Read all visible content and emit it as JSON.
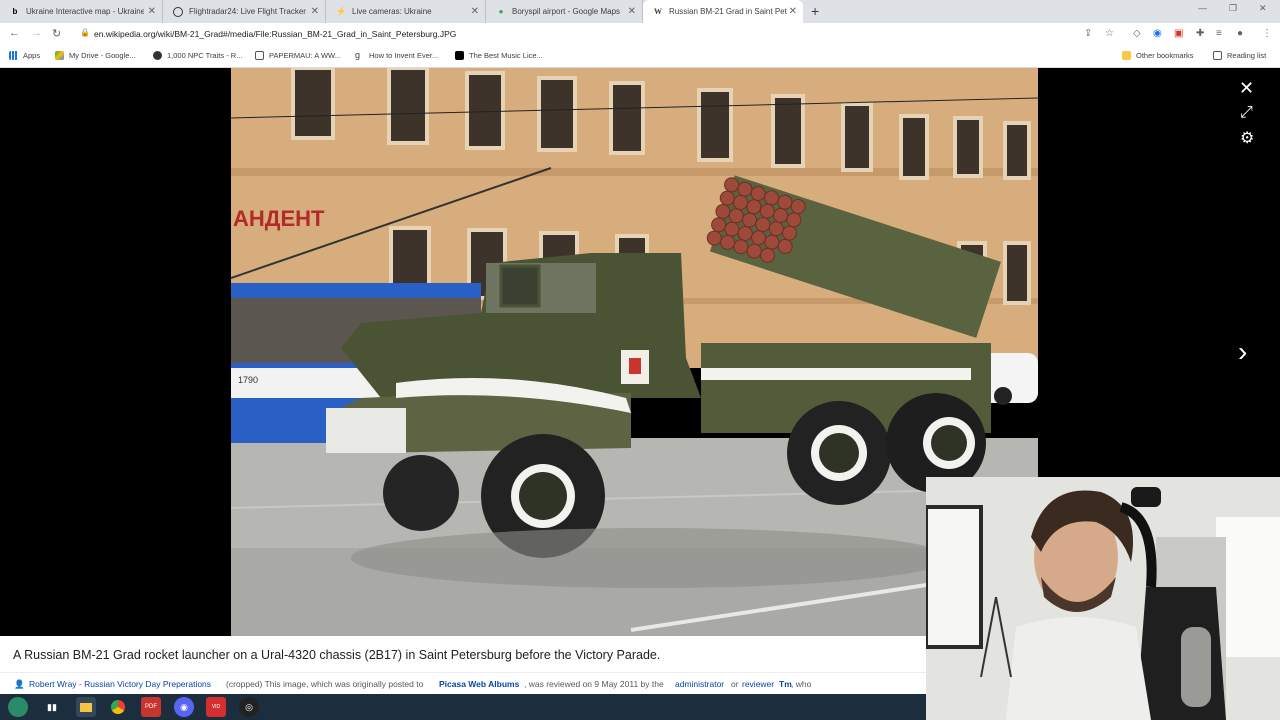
{
  "browser": {
    "tabs": [
      {
        "label": "Ukraine Interactive map - Ukraine",
        "icon": "liveuamap-icon",
        "active": false
      },
      {
        "label": "Flightradar24: Live Flight Tracker",
        "icon": "flightradar-icon",
        "active": false
      },
      {
        "label": "Live cameras: Ukraine",
        "icon": "camera-icon",
        "active": false
      },
      {
        "label": "Boryspil airport - Google Maps",
        "icon": "maps-pin-icon",
        "active": false
      },
      {
        "label": "Russian BM-21 Grad in Saint Peters",
        "icon": "wikipedia-icon",
        "active": true
      }
    ],
    "new_tab": "+",
    "url": "en.wikipedia.org/wiki/BM-21_Grad#/media/File:Russian_BM-21_Grad_in_Saint_Petersburg.JPG",
    "bookmarks": [
      {
        "label": "Apps",
        "icon": "apps-grid-icon"
      },
      {
        "label": "My Drive - Google...",
        "icon": "drive-icon"
      },
      {
        "label": "1,000 NPC Traits - R...",
        "icon": "npc-icon"
      },
      {
        "label": "PAPERMAU: A WW...",
        "icon": "papermau-icon"
      },
      {
        "label": "How to Invent Ever...",
        "icon": "g-icon"
      },
      {
        "label": "The Best Music Lice...",
        "icon": "music-icon"
      }
    ],
    "other_bookmarks": "Other bookmarks",
    "reading_list": "Reading list"
  },
  "viewer": {
    "sign_text": "АНДЕНТ",
    "bus_number": "1790",
    "caption": "A Russian BM-21 Grad rocket launcher on a Ural-4320 chassis (2B17) in Saint Petersburg before the Victory Parade.",
    "credits": {
      "author": "Robert Wray - Russian Victory Day Preperations",
      "cropped": "(cropped) This image, which was originally posted to",
      "source": "Picasa Web Albums",
      "reviewed": ", was reviewed on 9 May 2011 by the",
      "admin": "administrator",
      "or": "or",
      "reviewer": "reviewer",
      "reviewer_name": "Tm",
      "who": ", who"
    }
  },
  "taskbar": {
    "apps": [
      "start-icon",
      "taskview-icon",
      "file-explorer-icon",
      "chrome-icon",
      "pdf-app-icon",
      "discord-icon",
      "video-app-icon",
      "obs-icon"
    ]
  }
}
